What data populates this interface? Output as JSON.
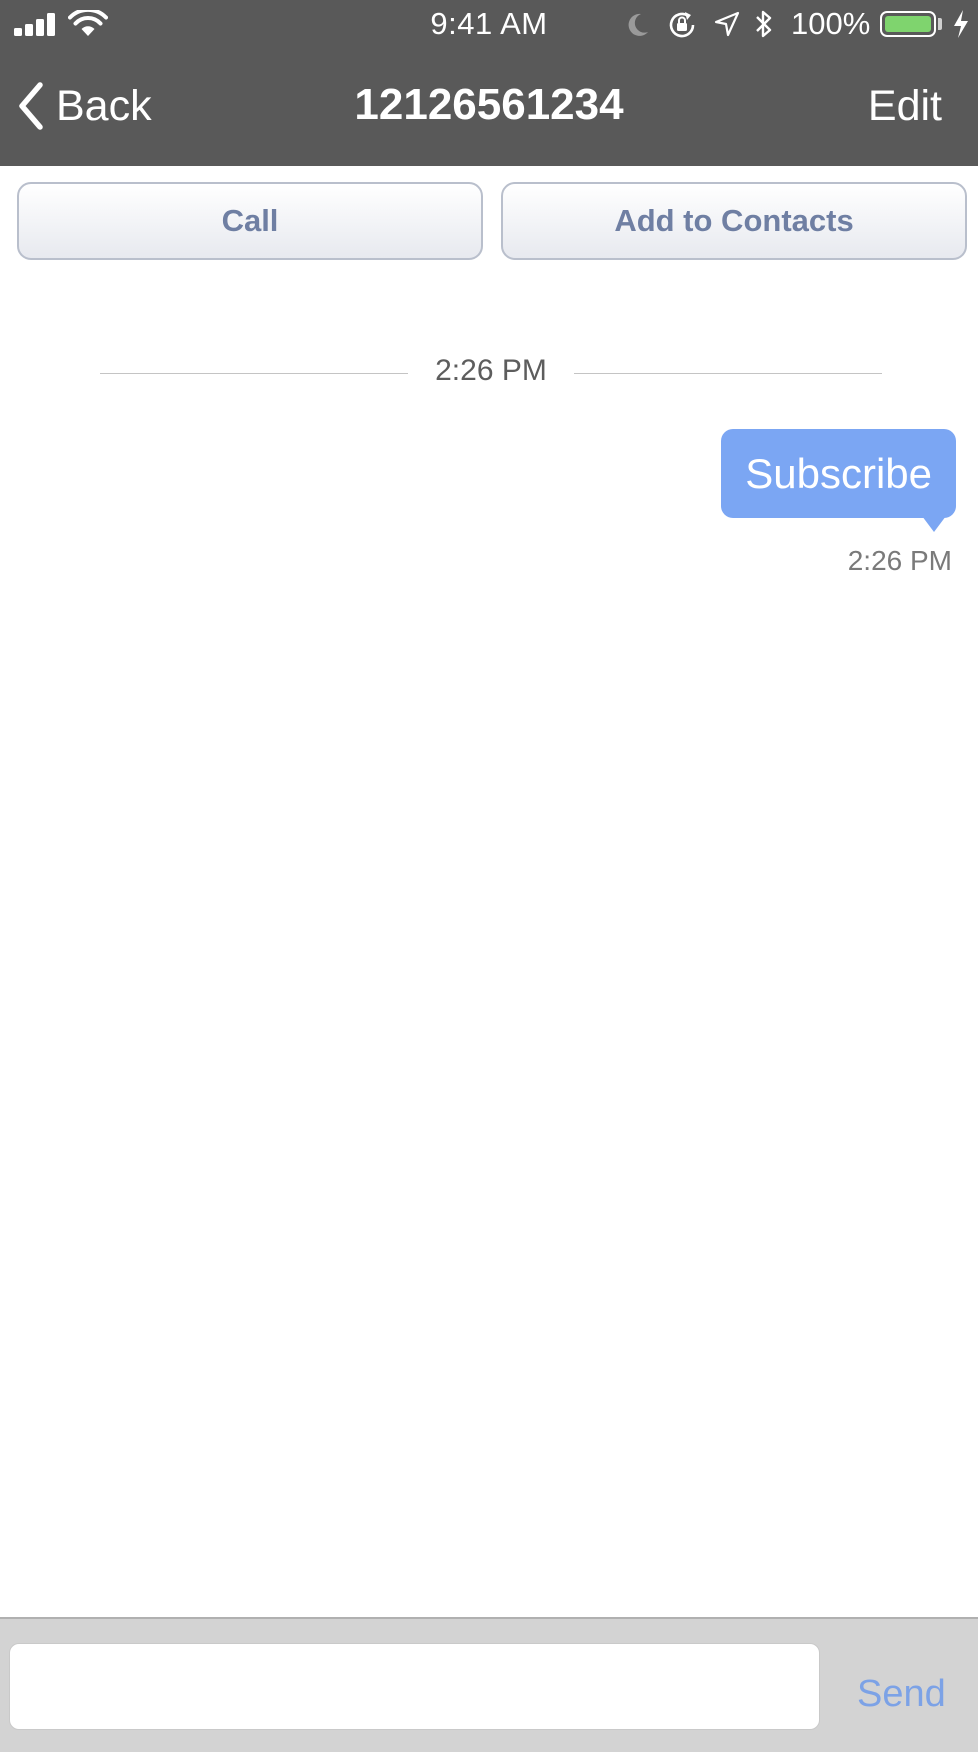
{
  "status_bar": {
    "time": "9:41 AM",
    "battery_percent": "100%",
    "battery_level": 1.0,
    "icons": [
      "signal-icon",
      "wifi-icon",
      "moon-icon",
      "lock-rotation-icon",
      "location-icon",
      "bluetooth-icon",
      "battery-icon",
      "charging-icon"
    ]
  },
  "nav": {
    "back_label": "Back",
    "title": "12126561234",
    "edit_label": "Edit"
  },
  "actions": {
    "call_label": "Call",
    "add_contacts_label": "Add to Contacts"
  },
  "conversation": {
    "date_separator": "2:26 PM",
    "messages": [
      {
        "direction": "outgoing",
        "text": "Subscribe",
        "time": "2:26 PM"
      }
    ]
  },
  "composer": {
    "input_value": "",
    "placeholder": "",
    "send_label": "Send"
  },
  "colors": {
    "bar_background": "#595959",
    "bubble": "#7ba6f3",
    "send_text": "#7ca2e6",
    "button_text": "#6f7fa3",
    "battery_fill": "#7fd46e"
  }
}
